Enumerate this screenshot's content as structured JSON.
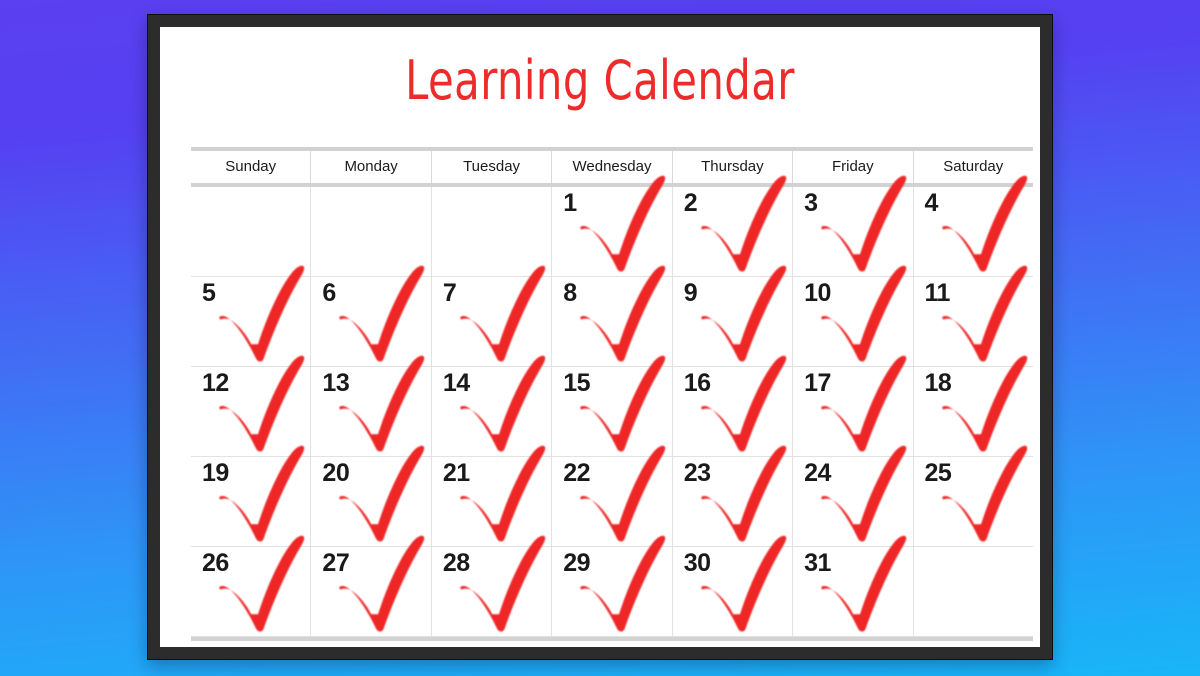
{
  "background": {
    "gradient_top": "#5B3FF0",
    "gradient_bottom": "#18B6F8"
  },
  "frame": {
    "color": "#2c2c2c",
    "paper_color": "#ffffff"
  },
  "calendar": {
    "title": "Learning Calendar",
    "title_color": "#ee2b2b",
    "check_color": "#ee2628",
    "grid_line_color": "#e2e2e2",
    "rule_color": "#d2d2d2",
    "day_headers": [
      "Sunday",
      "Monday",
      "Tuesday",
      "Wednesday",
      "Thursday",
      "Friday",
      "Saturday"
    ],
    "weeks": [
      [
        {
          "date": "",
          "checked": false
        },
        {
          "date": "",
          "checked": false
        },
        {
          "date": "",
          "checked": false
        },
        {
          "date": "1",
          "checked": true
        },
        {
          "date": "2",
          "checked": true
        },
        {
          "date": "3",
          "checked": true
        },
        {
          "date": "4",
          "checked": true
        }
      ],
      [
        {
          "date": "5",
          "checked": true
        },
        {
          "date": "6",
          "checked": true
        },
        {
          "date": "7",
          "checked": true
        },
        {
          "date": "8",
          "checked": true
        },
        {
          "date": "9",
          "checked": true
        },
        {
          "date": "10",
          "checked": true
        },
        {
          "date": "11",
          "checked": true
        }
      ],
      [
        {
          "date": "12",
          "checked": true
        },
        {
          "date": "13",
          "checked": true
        },
        {
          "date": "14",
          "checked": true
        },
        {
          "date": "15",
          "checked": true
        },
        {
          "date": "16",
          "checked": true
        },
        {
          "date": "17",
          "checked": true
        },
        {
          "date": "18",
          "checked": true
        }
      ],
      [
        {
          "date": "19",
          "checked": true
        },
        {
          "date": "20",
          "checked": true
        },
        {
          "date": "21",
          "checked": true
        },
        {
          "date": "22",
          "checked": true
        },
        {
          "date": "23",
          "checked": true
        },
        {
          "date": "24",
          "checked": true
        },
        {
          "date": "25",
          "checked": true
        }
      ],
      [
        {
          "date": "26",
          "checked": true
        },
        {
          "date": "27",
          "checked": true
        },
        {
          "date": "28",
          "checked": true
        },
        {
          "date": "29",
          "checked": true
        },
        {
          "date": "30",
          "checked": true
        },
        {
          "date": "31",
          "checked": true
        },
        {
          "date": "",
          "checked": false
        }
      ]
    ]
  }
}
